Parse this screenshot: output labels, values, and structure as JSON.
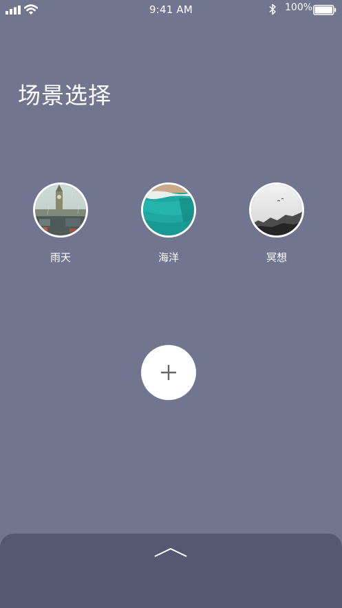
{
  "status_bar": {
    "time": "9:41 AM",
    "battery_percent": "100%",
    "battery_level": 1.0,
    "icons": [
      "signal-bars-icon",
      "wifi-icon",
      "bluetooth-icon",
      "battery-icon"
    ]
  },
  "page_title": "场景选择",
  "scenes": [
    {
      "label": "雨天",
      "image": "rainy-london-thumbnail"
    },
    {
      "label": "海洋",
      "image": "ocean-aerial-thumbnail"
    },
    {
      "label": "冥想",
      "image": "misty-forest-thumbnail"
    }
  ],
  "add_button": {
    "icon": "plus-icon"
  },
  "bottom_sheet": {
    "handle_icon": "chevron-up-icon"
  },
  "colors": {
    "background": "#717590",
    "bottom_sheet": "#545872",
    "text": "#ffffff",
    "button": "#ffffff",
    "plus": "#666666"
  }
}
